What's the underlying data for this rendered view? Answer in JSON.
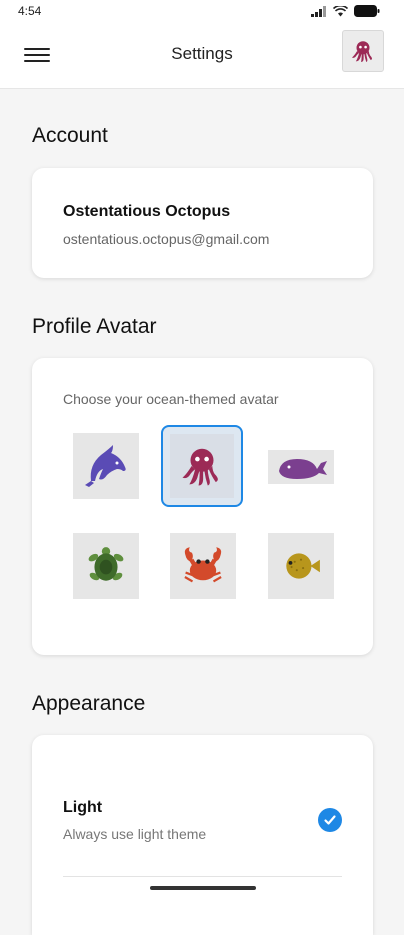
{
  "status_bar": {
    "time": "4:54"
  },
  "app_bar": {
    "title": "Settings"
  },
  "account": {
    "section_title": "Account",
    "name": "Ostentatious Octopus",
    "email": "ostentatious.octopus@gmail.com"
  },
  "avatar": {
    "section_title": "Profile Avatar",
    "prompt": "Choose your ocean-themed avatar",
    "selected": "octopus",
    "options": [
      "dolphin",
      "octopus",
      "whale",
      "turtle",
      "crab",
      "pufferfish"
    ]
  },
  "appearance": {
    "section_title": "Appearance",
    "option_name": "Light",
    "option_desc": "Always use light theme",
    "selected": true
  },
  "colors": {
    "accent": "#1e88e5",
    "dolphin": "#5a4bb5",
    "octopus": "#9c2a56",
    "whale": "#7b3f8f",
    "turtle": "#3f6b2a",
    "crab": "#d34a2b",
    "pufferfish": "#b8961c"
  }
}
